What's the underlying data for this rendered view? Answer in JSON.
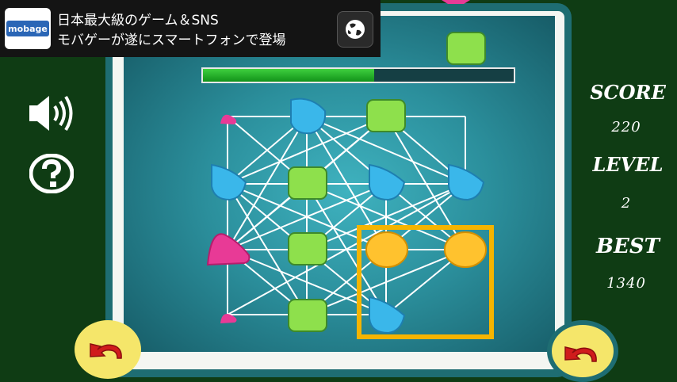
{
  "ad": {
    "logo_text": "mobage",
    "line1": "日本最大級のゲーム＆SNS",
    "line2": "モバゲーが遂にスマートフォンで登場",
    "globe_icon": "globe-icon"
  },
  "hud": {
    "score_label": "SCORE",
    "score_value": "220",
    "level_label": "LEVEL",
    "level_value": "2",
    "best_label": "BEST",
    "best_value": "1340"
  },
  "timer": {
    "progress_fraction": 0.55,
    "color": "#1aa81a"
  },
  "icons": {
    "sound": "speaker-icon",
    "help": "question-icon",
    "undo_left": "undo-arrow-icon",
    "undo_right": "redo-arrow-icon"
  },
  "colors": {
    "board_gradient_center": "#3fb2bf",
    "board_gradient_edge": "#155863",
    "frame": "#1e6d72",
    "background": "#0f3c14",
    "selection": "#f5b400",
    "round_button": "#f5e66a",
    "arrow": "#d01c1c",
    "square_piece": "#8ee04c",
    "teardrop_piece": "#3ab7ea",
    "triangle_piece": "#e83a96",
    "circle_piece": "#ffc22e"
  }
}
